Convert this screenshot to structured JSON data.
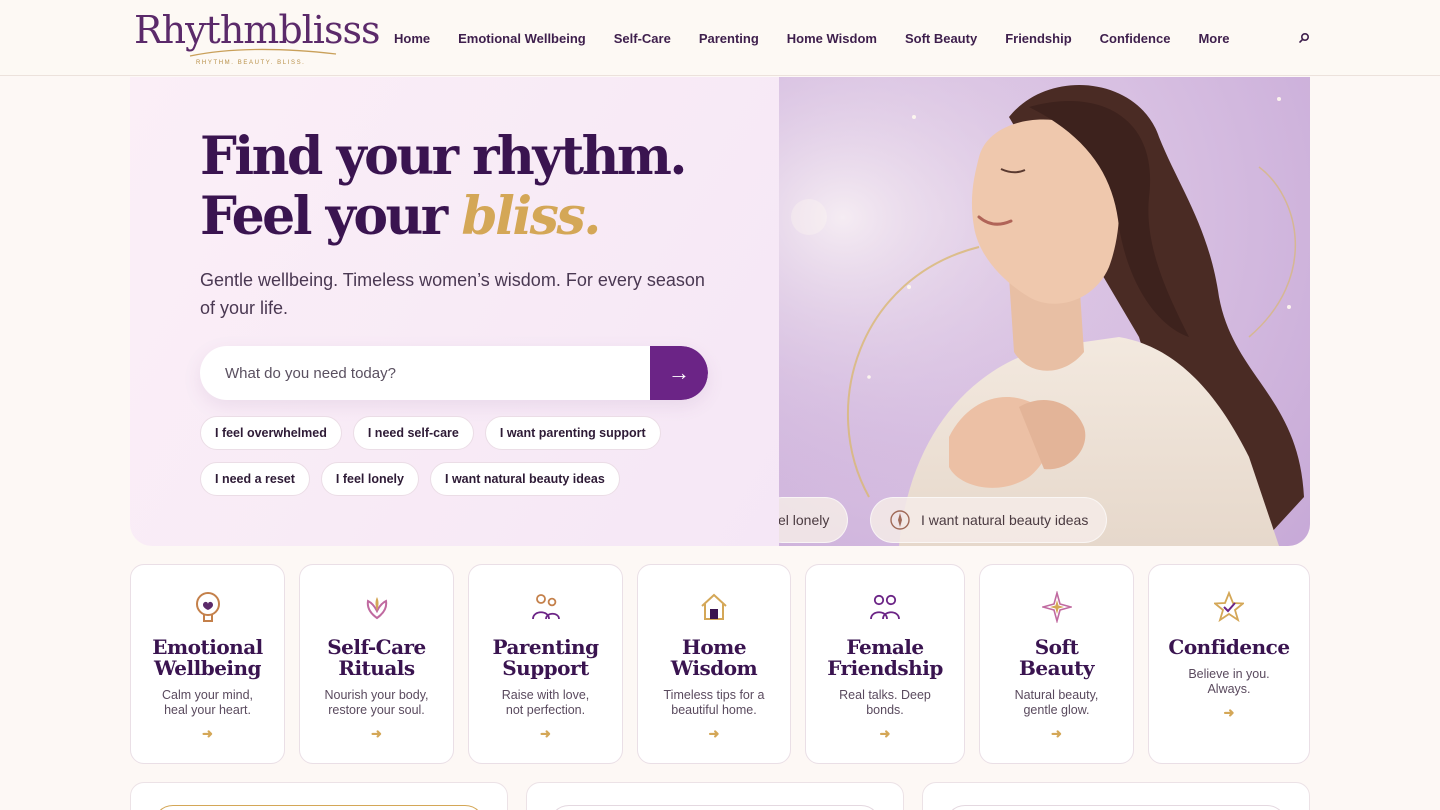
{
  "header": {
    "logo_text": "Rhythmblisss",
    "logo_tagline": "RHYTHM. BEAUTY. BLISS.",
    "nav": [
      {
        "label": "Home"
      },
      {
        "label": "Emotional Wellbeing"
      },
      {
        "label": "Self-Care"
      },
      {
        "label": "Parenting"
      },
      {
        "label": "Home Wisdom"
      },
      {
        "label": "Soft Beauty"
      },
      {
        "label": "Friendship"
      },
      {
        "label": "Confidence"
      },
      {
        "label": "More"
      }
    ],
    "search_icon": "search-icon"
  },
  "hero": {
    "title_line1": "Find your rhythm.",
    "title_line2_prefix": "Feel your ",
    "title_line2_accent": "bliss.",
    "subtitle": "Gentle wellbeing. Timeless women’s wisdom. For every season of your life.",
    "search_placeholder": "What do you need today?",
    "search_button": "→",
    "chips_row1": [
      "I feel overwhelmed",
      "I need self-care",
      "I want parenting support"
    ],
    "chips_row2": [
      "I need a reset",
      "I feel lonely",
      "I want natural beauty ideas"
    ],
    "photo_chips": [
      "el lonely",
      "I want natural beauty ideas"
    ]
  },
  "categories": [
    {
      "title_line1": "Emotional",
      "title_line2": "Wellbeing",
      "desc_line1": "Calm your mind,",
      "desc_line2": "heal your heart.",
      "arrow": "➜",
      "icon": "heart-mind-icon"
    },
    {
      "title_line1": "Self-Care",
      "title_line2": "Rituals",
      "desc_line1": "Nourish your body,",
      "desc_line2": "restore your soul.",
      "arrow": "➜",
      "icon": "lotus-icon"
    },
    {
      "title_line1": "Parenting",
      "title_line2": "Support",
      "desc_line1": "Raise with love,",
      "desc_line2": "not perfection.",
      "arrow": "➜",
      "icon": "family-icon"
    },
    {
      "title_line1": "Home",
      "title_line2": "Wisdom",
      "desc_line1": "Timeless tips for a",
      "desc_line2": "beautiful home.",
      "arrow": "➜",
      "icon": "house-icon"
    },
    {
      "title_line1": "Female",
      "title_line2": "Friendship",
      "desc_line1": "Real talks. Deep",
      "desc_line2": "bonds.",
      "arrow": "➜",
      "icon": "friends-icon"
    },
    {
      "title_line1": "Soft",
      "title_line2": "Beauty",
      "desc_line1": "Natural beauty,",
      "desc_line2": "gentle glow.",
      "arrow": "➜",
      "icon": "sparkle-icon"
    },
    {
      "title_line1": "Confidence",
      "title_line2": "",
      "desc_line1": "Believe in you.",
      "desc_line2": "Always.",
      "arrow": "➜",
      "icon": "star-check-icon"
    }
  ],
  "colors": {
    "brand_purple": "#6b2486",
    "heading_purple": "#3a1450",
    "gold_accent": "#d4a757",
    "page_background": "#fdf8f5"
  }
}
